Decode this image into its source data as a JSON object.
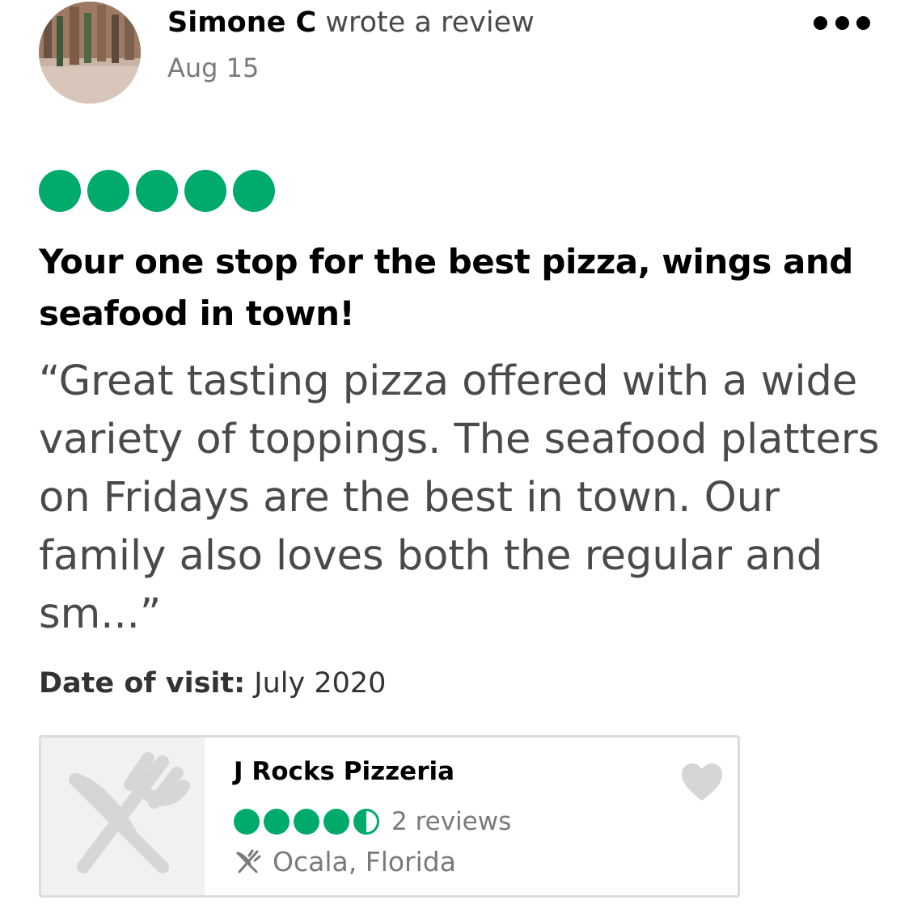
{
  "review": {
    "author_name": "Simone C",
    "author_action": "wrote a review",
    "date": "Aug 15",
    "rating": 5,
    "title": "Your one stop for the best pizza, wings and seafood in town!",
    "body": "“Great tasting pizza offered with a wide variety of toppings. The seafood platters on Fridays are the best in town. Our family also loves both the regular and sm...”",
    "visit_label": "Date of visit:",
    "visit_value": "July 2020"
  },
  "business": {
    "name": "J Rocks Pizzeria",
    "rating": 4.5,
    "reviews": "2 reviews",
    "location": "Ocala, Florida"
  },
  "icons": {
    "more": "more-options-icon",
    "heart": "heart-icon",
    "restaurant": "fork-knife-icon",
    "placeholder": "restaurant-placeholder-icon"
  },
  "colors": {
    "rating_green": "#00aa6c",
    "text_primary": "#000000",
    "text_secondary": "#4a4a4a",
    "text_muted": "#7a7a7a",
    "card_border": "#dcdcdc",
    "heart_gray": "#d6d6d6"
  }
}
